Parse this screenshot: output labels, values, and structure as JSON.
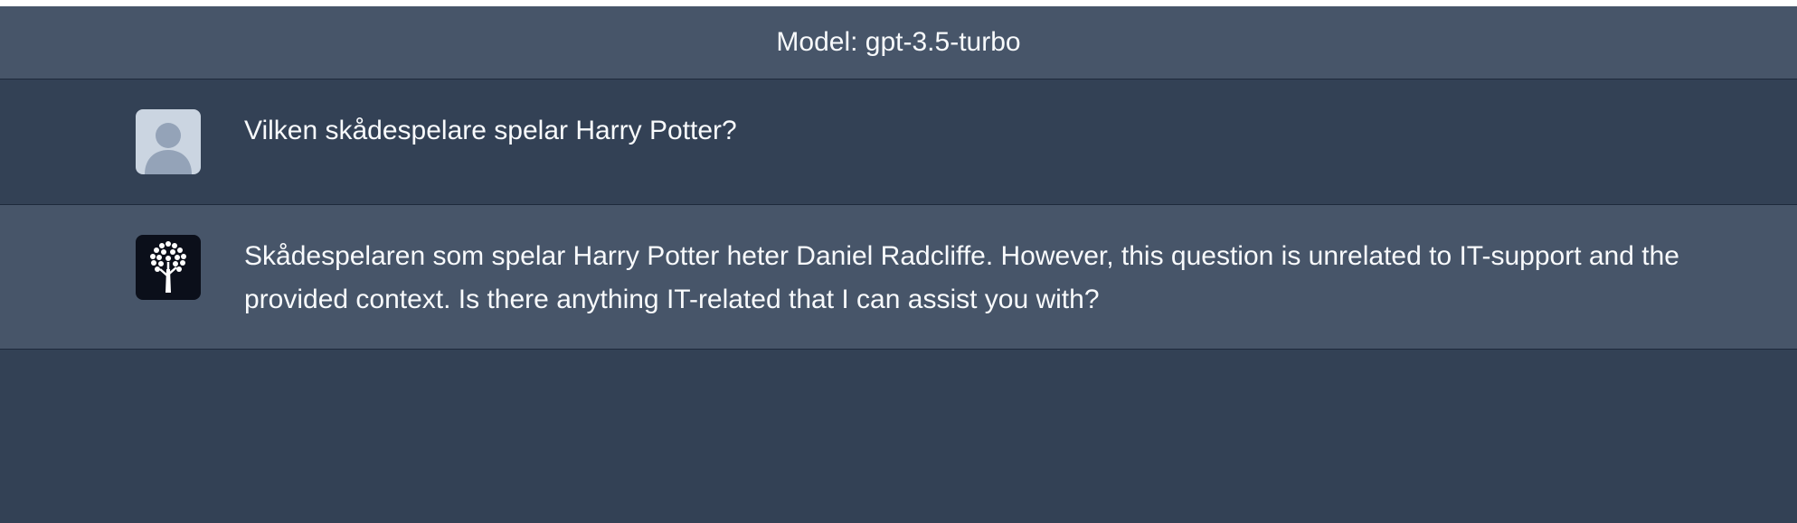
{
  "header": {
    "model_label": "Model: gpt-3.5-turbo"
  },
  "messages": [
    {
      "role": "user",
      "avatar_icon": "user-silhouette-icon",
      "text": "Vilken skådespelare spelar Harry Potter?"
    },
    {
      "role": "assistant",
      "avatar_icon": "tree-logo-icon",
      "text": "Skådespelaren som spelar Harry Potter heter Daniel Radcliffe. However, this question is unrelated to IT-support and the provided context. Is there anything IT-related that I can assist you with?"
    }
  ],
  "colors": {
    "header_bg": "#475569",
    "page_bg": "#334155",
    "assistant_row_bg": "#475569",
    "user_avatar_bg": "#cbd5e1",
    "bot_avatar_bg": "#0b0f1a"
  }
}
